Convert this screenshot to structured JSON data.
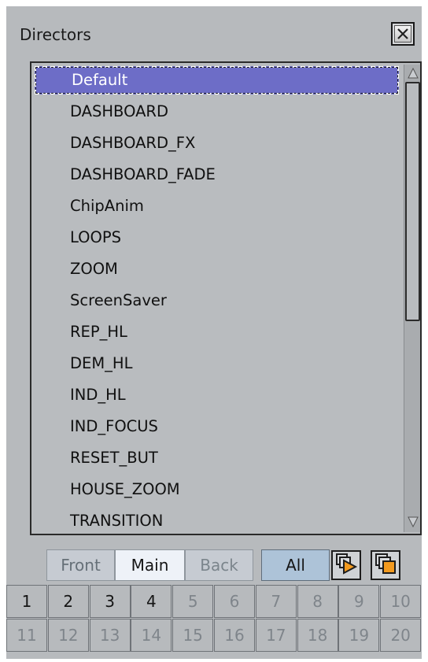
{
  "window": {
    "title": "Directors"
  },
  "directors": [
    "Default",
    "DASHBOARD",
    "DASHBOARD_FX",
    "DASHBOARD_FADE",
    "ChipAnim",
    "LOOPS",
    "ZOOM",
    "ScreenSaver",
    "REP_HL",
    "DEM_HL",
    "IND_HL",
    "IND_FOCUS",
    "RESET_BUT",
    "HOUSE_ZOOM",
    "TRANSITION"
  ],
  "selected_director": "Default",
  "tabs": {
    "front": "Front",
    "main": "Main",
    "back": "Back",
    "all": "All",
    "active": "Main"
  },
  "icons": {
    "close": "close-icon",
    "play": "play-forward-icon",
    "stop": "stop-icon"
  },
  "layers": {
    "active": [
      1,
      2,
      3,
      4
    ],
    "numbers": [
      "1",
      "2",
      "3",
      "4",
      "5",
      "6",
      "7",
      "8",
      "9",
      "10",
      "11",
      "12",
      "13",
      "14",
      "15",
      "16",
      "17",
      "18",
      "19",
      "20"
    ]
  },
  "colors": {
    "panel": "#b7babd",
    "selection": "#6d6dc7",
    "tab_all": "#adc3d8",
    "accent_orange": "#f29a1f"
  }
}
